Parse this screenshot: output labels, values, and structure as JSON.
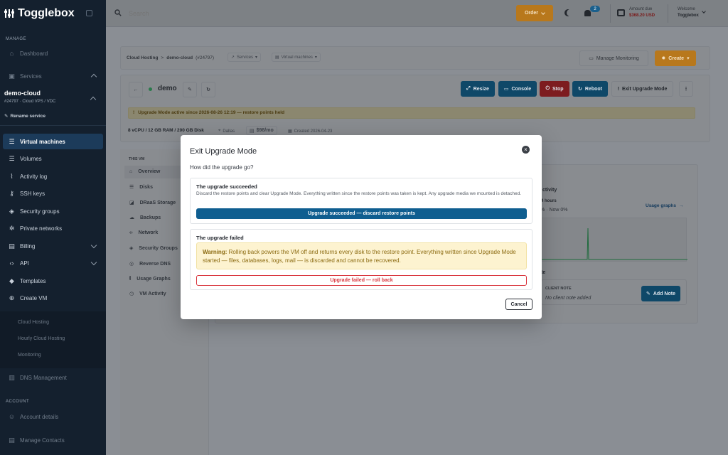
{
  "brand": {
    "name": "Togglebox"
  },
  "sidebar": {
    "manage_label": "MANAGE",
    "account_label": "ACCOUNT",
    "dashboard": "Dashboard",
    "services": "Services",
    "service_name": "demo-cloud",
    "service_sub": "#24797 · Cloud VPS / VDC",
    "rename": "Rename service",
    "items": [
      {
        "label": "Virtual machines"
      },
      {
        "label": "Volumes"
      },
      {
        "label": "Activity log"
      },
      {
        "label": "SSH keys"
      },
      {
        "label": "Security groups"
      },
      {
        "label": "Private networks"
      },
      {
        "label": "Billing"
      },
      {
        "label": "API"
      },
      {
        "label": "Templates"
      },
      {
        "label": "Create VM"
      }
    ],
    "sub_links": [
      "Cloud Hosting",
      "Hourly Cloud Hosting",
      "Monitoring"
    ],
    "dns": "DNS Management",
    "account_details": "Account details",
    "manage_contacts": "Manage Contacts"
  },
  "topbar": {
    "search_placeholder": "Search",
    "order": "Order",
    "notifications_count": "2",
    "amount_label": "Amount due",
    "amount_value": "$368.20 USD",
    "welcome": "Welcome",
    "user": "Togglebox"
  },
  "breadcrumb": {
    "root": "Cloud Hosting",
    "service": "demo-cloud",
    "id": "(#24797)",
    "services": "Services",
    "vms": "Virtual machines"
  },
  "header_actions": {
    "manage_monitoring": "Manage Monitoring",
    "create": "Create"
  },
  "vm": {
    "name": "demo",
    "actions": {
      "resize": "Resize",
      "console": "Console",
      "stop": "Stop",
      "reboot": "Reboot",
      "exit_upgrade": "Exit Upgrade Mode"
    },
    "banner": "Upgrade Mode active since 2026-08-26 12:19 — restore points held",
    "specs": "8 vCPU / 12 GB RAM / 200 GB Disk",
    "location": "Dallas",
    "price": "$98/mo",
    "created": "Created 2026-04-23"
  },
  "vm_menu": {
    "section": "THIS VM",
    "items": [
      "Overview",
      "Disks",
      "DRaaS Storage",
      "Backups",
      "Network",
      "Security Groups",
      "Reverse DNS",
      "Usage Graphs",
      "VM Activity"
    ]
  },
  "panel": {
    "activity": "ctivity",
    "hours": "4 hours",
    "now": "% · Now 0%",
    "usage_graphs": "Usage graphs",
    "notes_title": "te",
    "client_note_label": "CLIENT NOTE",
    "client_note_value": "No client note added",
    "add_note": "Add Note"
  },
  "modal": {
    "title": "Exit Upgrade Mode",
    "question": "How did the upgrade go?",
    "success": {
      "title": "The upgrade succeeded",
      "body": "Discard the restore points and clear Upgrade Mode. Everything written since the restore points was taken is kept. Any upgrade media we mounted is detached.",
      "button": "Upgrade succeeded — discard restore points"
    },
    "failure": {
      "title": "The upgrade failed",
      "warning_label": "Warning:",
      "warning_text": "Rolling back powers the VM off and returns every disk to the restore point. Everything written since Upgrade Mode started — files, databases, logs, mail — is discarded and cannot be recovered.",
      "button": "Upgrade failed — roll back"
    },
    "cancel": "Cancel"
  },
  "colors": {
    "accent": "#0f5e90",
    "danger": "#d9363e",
    "warning_bg": "#fdf3d0",
    "warning_text": "#8b6a10",
    "order": "#b8781c"
  }
}
